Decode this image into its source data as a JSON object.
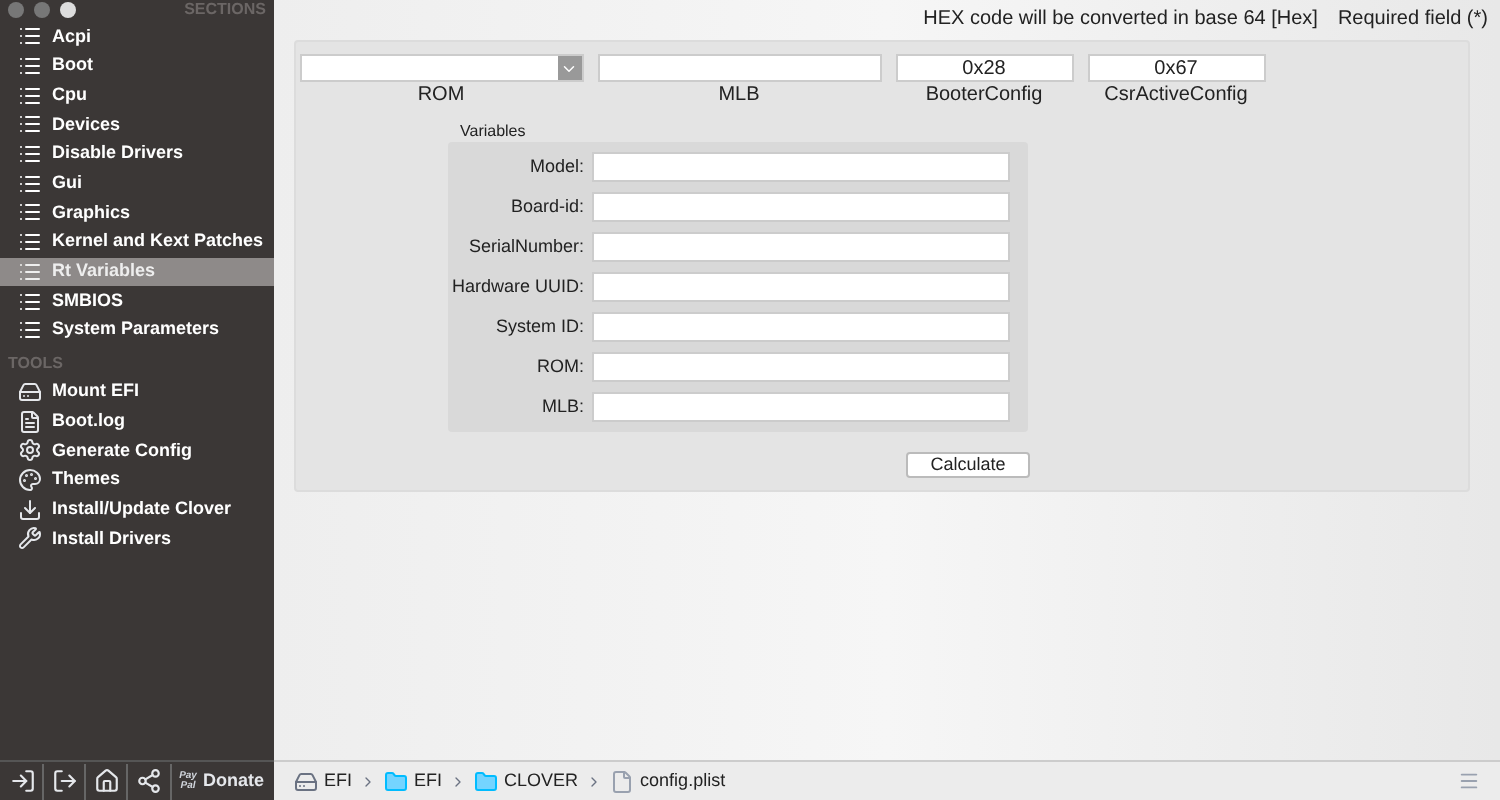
{
  "window": {
    "traffic_lights": [
      {
        "kind": "close"
      },
      {
        "kind": "minimize"
      },
      {
        "kind": "zoom"
      }
    ]
  },
  "sidebar": {
    "sections_heading": "SECTIONS",
    "sections": [
      {
        "label": "Acpi",
        "selected": false
      },
      {
        "label": "Boot",
        "selected": false
      },
      {
        "label": "Cpu",
        "selected": false
      },
      {
        "label": "Devices",
        "selected": false
      },
      {
        "label": "Disable Drivers",
        "selected": false
      },
      {
        "label": "Gui",
        "selected": false
      },
      {
        "label": "Graphics",
        "selected": false
      },
      {
        "label": "Kernel and Kext Patches",
        "selected": false
      },
      {
        "label": "Rt Variables",
        "selected": true
      },
      {
        "label": "SMBIOS",
        "selected": false
      },
      {
        "label": "System Parameters",
        "selected": false
      }
    ],
    "tools_heading": "TOOLS",
    "tools": [
      {
        "label": "Mount EFI",
        "kind": "disk"
      },
      {
        "label": "Boot.log",
        "kind": "log"
      },
      {
        "label": "Generate Config",
        "kind": "gears"
      },
      {
        "label": "Themes",
        "kind": "palette"
      },
      {
        "label": "Install/Update Clover",
        "kind": "download"
      },
      {
        "label": "Install Drivers",
        "kind": "tools"
      }
    ]
  },
  "footer": {
    "buttons": [
      {
        "kind": "import"
      },
      {
        "kind": "export"
      },
      {
        "kind": "home"
      },
      {
        "kind": "share"
      }
    ],
    "donate": {
      "logo_top": "Pay",
      "logo_bottom": "Pal",
      "label": "Donate"
    }
  },
  "header": {
    "hex_note": "HEX code will be converted in base 64 [Hex]",
    "required_note": "Required field (*)"
  },
  "top_fields": [
    {
      "label": "ROM",
      "kind": "combo"
    },
    {
      "label": "MLB",
      "kind": "text"
    },
    {
      "label": "BooterConfig",
      "value": "0x28",
      "kind": "text"
    },
    {
      "label": "CsrActiveConfig",
      "value": "0x67",
      "kind": "text"
    }
  ],
  "variables": {
    "title": "Variables",
    "fields": [
      {
        "label": "Model:"
      },
      {
        "label": "Board-id:"
      },
      {
        "label": "SerialNumber:"
      },
      {
        "label": "Hardware UUID:"
      },
      {
        "label": "System ID:"
      },
      {
        "label": "ROM:"
      },
      {
        "label": "MLB:"
      }
    ]
  },
  "calculate_button": "Calculate",
  "path_bar": [
    {
      "label": "EFI",
      "kind": "drive"
    },
    {
      "label": "EFI",
      "kind": "folder"
    },
    {
      "label": "CLOVER",
      "kind": "folder"
    },
    {
      "label": "config.plist",
      "kind": "file"
    }
  ]
}
